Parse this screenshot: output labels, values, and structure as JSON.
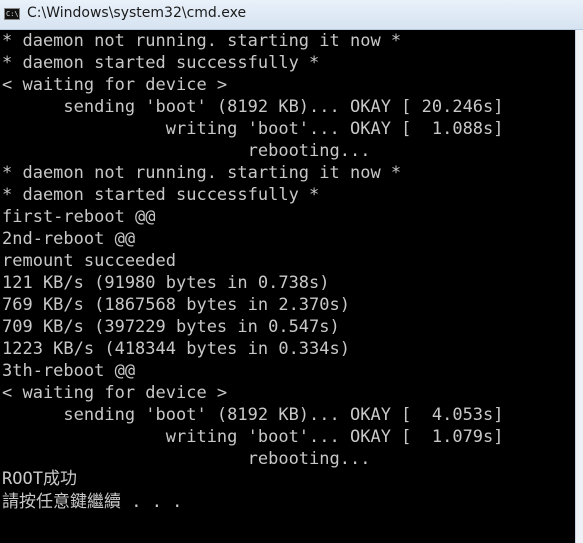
{
  "window": {
    "title": "C:\\Windows\\system32\\cmd.exe",
    "icon": "cmd-console-icon",
    "icon_glyph": "C:\\."
  },
  "console": {
    "lines": [
      "* daemon not running. starting it now *",
      "* daemon started successfully *",
      "< waiting for device >",
      "      sending 'boot' (8192 KB)... OKAY [ 20.246s]",
      "                writing 'boot'... OKAY [  1.088s]",
      "                        rebooting...",
      "* daemon not running. starting it now *",
      "* daemon started successfully *",
      "first-reboot @@",
      "2nd-reboot @@",
      "remount succeeded",
      "121 KB/s (91980 bytes in 0.738s)",
      "769 KB/s (1867568 bytes in 2.370s)",
      "709 KB/s (397229 bytes in 0.547s)",
      "1223 KB/s (418344 bytes in 0.334s)",
      "3th-reboot @@",
      "< waiting for device >",
      "      sending 'boot' (8192 KB)... OKAY [  4.053s]",
      "                writing 'boot'... OKAY [  1.079s]",
      "                        rebooting...",
      "",
      "ROOT成功",
      "請按任意鍵繼續 . . ."
    ]
  }
}
